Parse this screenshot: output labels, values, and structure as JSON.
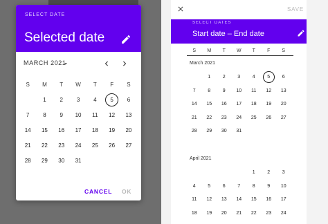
{
  "left": {
    "overline": "SELECT DATE",
    "headline": "Selected date",
    "month_label": "MARCH 2021",
    "weekdays": [
      "S",
      "M",
      "T",
      "W",
      "T",
      "F",
      "S"
    ],
    "days": [
      "",
      "1",
      "2",
      "3",
      "4",
      "5",
      "6",
      "7",
      "8",
      "9",
      "10",
      "11",
      "12",
      "13",
      "14",
      "15",
      "16",
      "17",
      "18",
      "19",
      "20",
      "21",
      "22",
      "23",
      "24",
      "25",
      "26",
      "27",
      "28",
      "29",
      "30",
      "31"
    ],
    "today": "5",
    "cancel_label": "CANCEL",
    "ok_label": "OK"
  },
  "right": {
    "overline": "SELECT DATES",
    "headline": "Start date – End date",
    "save_label": "SAVE",
    "weekdays": [
      "S",
      "M",
      "T",
      "W",
      "T",
      "F",
      "S"
    ],
    "months": [
      {
        "title": "March 2021",
        "days": [
          "",
          "1",
          "2",
          "3",
          "4",
          "5",
          "6",
          "7",
          "8",
          "9",
          "10",
          "11",
          "12",
          "13",
          "14",
          "15",
          "16",
          "17",
          "18",
          "19",
          "20",
          "21",
          "22",
          "23",
          "24",
          "25",
          "26",
          "27",
          "28",
          "29",
          "30",
          "31"
        ],
        "today": "5"
      },
      {
        "title": "April 2021",
        "days": [
          "",
          "",
          "",
          "",
          "1",
          "2",
          "3",
          "4",
          "5",
          "6",
          "7",
          "8",
          "9",
          "10",
          "11",
          "12",
          "13",
          "14",
          "15",
          "16",
          "17",
          "18",
          "19",
          "20",
          "21",
          "22",
          "23",
          "24"
        ],
        "today": ""
      }
    ]
  },
  "colors": {
    "primary": "#6200ee",
    "scrim": "#6e6e6e",
    "disabled_text": "#b8b8b8"
  },
  "icons": {
    "edit": "pencil-icon",
    "dropdown": "arrow-drop-down-icon",
    "prev": "chevron-left-icon",
    "next": "chevron-right-icon",
    "close": "close-icon"
  }
}
